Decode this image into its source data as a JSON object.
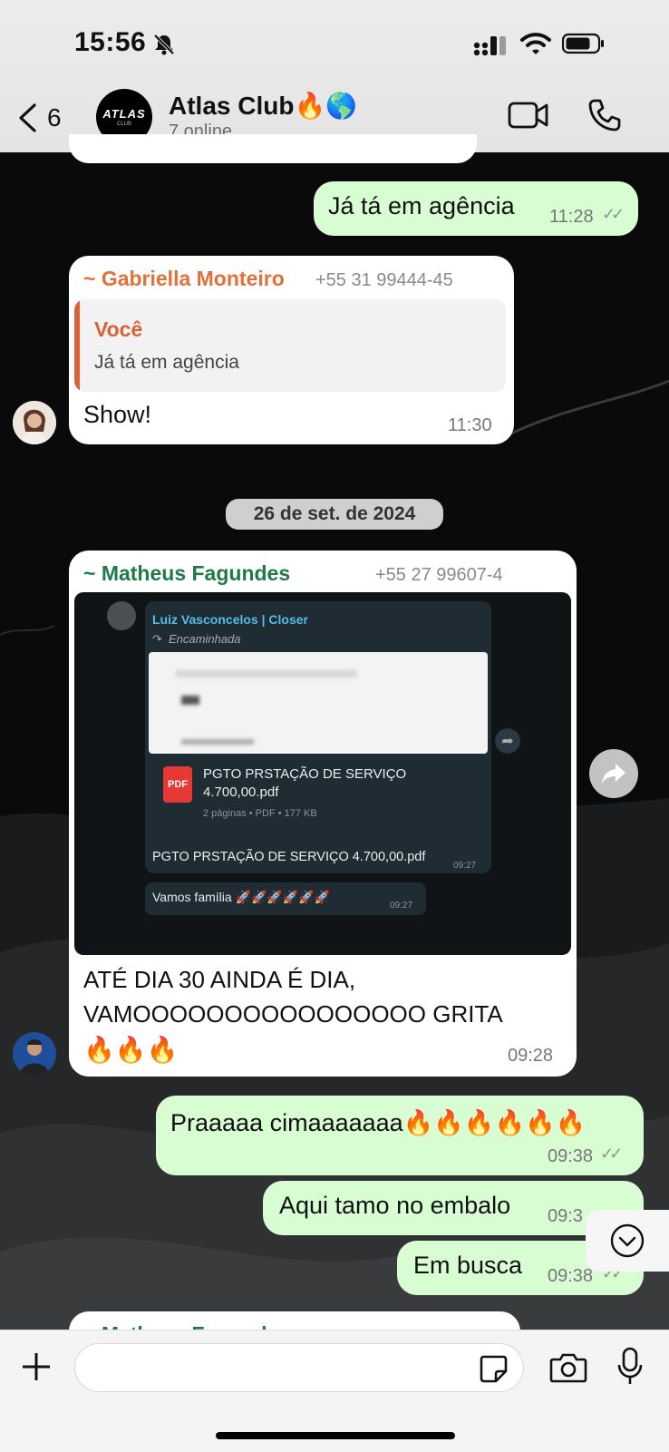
{
  "status_bar": {
    "time": "15:56"
  },
  "header": {
    "back_count": "6",
    "title": "Atlas Club🔥🌎",
    "subtitle": "7 online",
    "avatar_text": "ATLAS",
    "avatar_subtext": "CLUB"
  },
  "messages": {
    "out1": {
      "text": "Já tá em agência",
      "time": "11:28"
    },
    "gabriella": {
      "sender": "~ Gabriella Monteiro",
      "phone": "+55 31 99444-45",
      "quote_author": "Você",
      "quote_text": "Já tá em agência",
      "text": "Show!",
      "time": "11:30"
    },
    "date_chip": "26 de set. de 2024",
    "matheus": {
      "sender": "~ Matheus Fagundes",
      "phone": "+55 27 99607-4",
      "fwd_sender": "Luiz Vasconcelos | Closer",
      "fwd_label": "Encaminhada",
      "pdf_name_line1": "PGTO PRSTAÇÃO DE SERVIÇO",
      "pdf_name_line2": "4.700,00.pdf",
      "pdf_meta": "2 páginas • PDF • 177 KB",
      "pdf_icon_label": "PDF",
      "pdf_caption": "PGTO PRSTAÇÃO DE SERVIÇO 4.700,00.pdf",
      "pdf_time": "09:27",
      "inner_msg": "Vamos família 🚀🚀🚀🚀🚀🚀",
      "inner_time": "09:27",
      "text_line1": "ATÉ DIA 30 AINDA É DIA,",
      "text_line2": "VAMOOOOOOOOOOOOOOOO GRITA",
      "text_line3": "🔥🔥🔥",
      "time": "09:28"
    },
    "out2": {
      "text": "Praaaaa cimaaaaaaa🔥🔥🔥🔥🔥🔥",
      "time": "09:38"
    },
    "out3": {
      "text": "Aqui tamo no embalo",
      "time": "09:3"
    },
    "out4": {
      "text": "Em busca",
      "time": "09:38"
    },
    "partial_sender": "~ Matheus Fagundes"
  },
  "colors": {
    "incoming_bubble": "#ffffff",
    "outgoing_bubble": "#d9fdd3",
    "gabriella_name": "#e2703a",
    "matheus_name": "#1f7a4a",
    "quote_bar": "#d9623a"
  },
  "icons": [
    "bell-slash-icon",
    "signal-icon",
    "wifi-icon",
    "battery-icon",
    "chevron-left-icon",
    "video-camera-icon",
    "phone-icon",
    "forward-icon",
    "chevron-down-icon",
    "plus-icon",
    "sticker-icon",
    "camera-icon",
    "microphone-icon",
    "pdf-icon"
  ]
}
